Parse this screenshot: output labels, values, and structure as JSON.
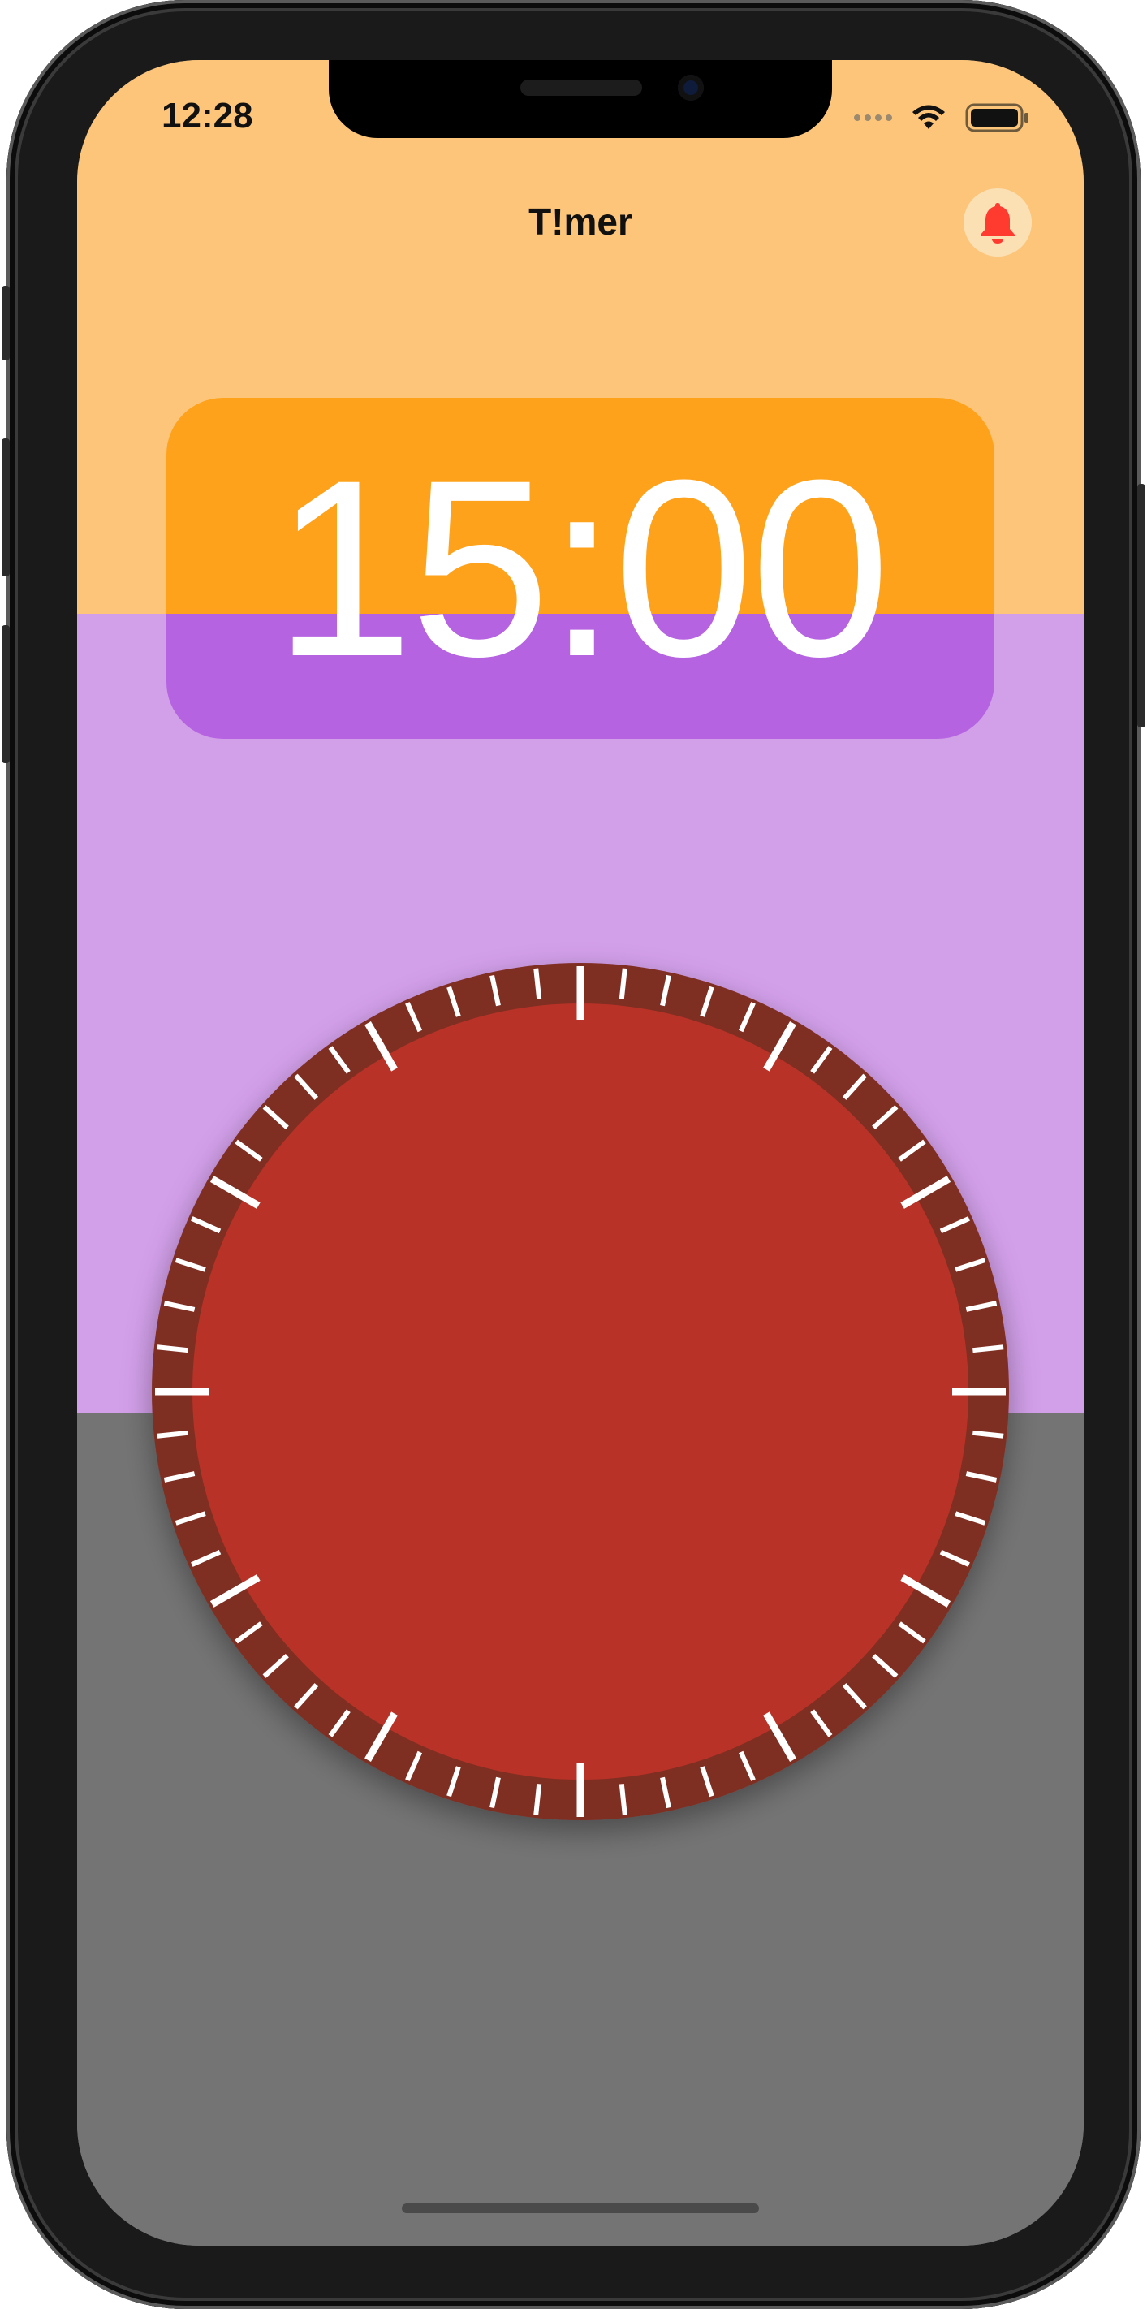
{
  "status_bar": {
    "time": "12:28"
  },
  "nav": {
    "title": "T!mer"
  },
  "timer": {
    "display": "15:00"
  },
  "dial": {
    "tick_count": 60,
    "remaining_fraction": 1.0
  },
  "colors": {
    "top_band": "#fcc57a",
    "middle_band": "#d29fe9",
    "bottom_band": "#747474",
    "display_top": "#fea21c",
    "display_bottom": "#b563e1",
    "dial_fill": "#b83227",
    "dial_rim": "#7f2f24",
    "bell_accent": "#ff3b30"
  },
  "icons": {
    "bell": "bell-icon",
    "wifi": "wifi-icon",
    "battery": "battery-icon",
    "signal": "signal-icon"
  }
}
